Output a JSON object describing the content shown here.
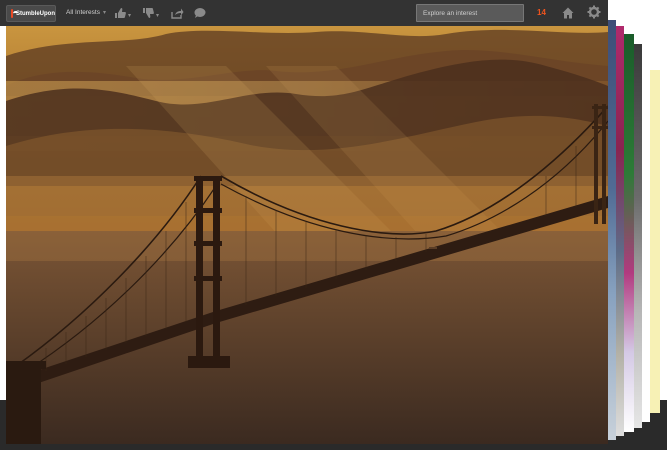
{
  "toolbar": {
    "stumble_label": "StumbleUpon",
    "interests_label": "All Interests",
    "search_placeholder": "Explore an interest",
    "stumble_count": "14"
  },
  "icons": {
    "logo": "stumbleupon-logo-icon",
    "like": "thumbs-up-icon",
    "dislike": "thumbs-down-icon",
    "share": "share-icon",
    "comment": "comment-icon",
    "home": "home-icon",
    "settings": "gear-icon"
  },
  "colors": {
    "toolbar": "#333333",
    "accent": "#eb4924",
    "count": "#f0541e"
  }
}
